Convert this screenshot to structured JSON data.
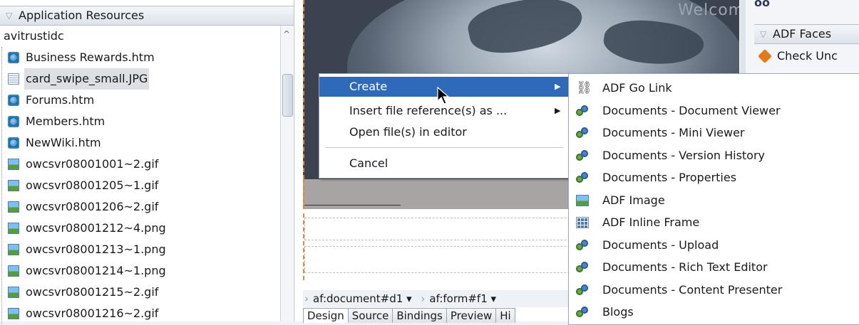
{
  "left_panel": {
    "header": "Application Resources",
    "root": "avitrustidc",
    "files": [
      {
        "name": "Business Rewards.htm",
        "icon": "html-page-icon"
      },
      {
        "name": "card_swipe_small.JPG",
        "icon": "document-icon"
      },
      {
        "name": "Forums.htm",
        "icon": "html-page-icon"
      },
      {
        "name": "Members.htm",
        "icon": "html-page-icon"
      },
      {
        "name": "NewWiki.htm",
        "icon": "html-page-icon"
      },
      {
        "name": "owcsvr08001001~2.gif",
        "icon": "image-icon"
      },
      {
        "name": "owcsvr08001205~1.gif",
        "icon": "image-icon"
      },
      {
        "name": "owcsvr08001206~2.gif",
        "icon": "image-icon"
      },
      {
        "name": "owcsvr08001212~4.png",
        "icon": "image-icon"
      },
      {
        "name": "owcsvr08001213~1.png",
        "icon": "image-icon"
      },
      {
        "name": "owcsvr08001214~1.png",
        "icon": "image-icon"
      },
      {
        "name": "owcsvr08001215~2.gif",
        "icon": "image-icon"
      },
      {
        "name": "owcsvr08001216~2.gif",
        "icon": "image-icon"
      }
    ],
    "selected_index": 1
  },
  "editor": {
    "welcome_text": "Welcom",
    "breadcrumb": [
      "af:document#d1 ▾",
      "af:form#f1 ▾"
    ],
    "tabs": [
      "Design",
      "Source",
      "Bindings",
      "Preview",
      "Hi"
    ],
    "active_tab": "Design"
  },
  "right_panel": {
    "header": "ADF Faces",
    "item": "Check Unc"
  },
  "context_menu": {
    "items": [
      "Create",
      "Insert file reference(s) as ...",
      "Open file(s) in editor",
      "Cancel"
    ],
    "highlight_color": "#2f6ab8"
  },
  "submenu": {
    "items": [
      {
        "label": "ADF Go Link",
        "icon": "link-icon"
      },
      {
        "label": "Documents - Document Viewer",
        "icon": "component-icon"
      },
      {
        "label": "Documents - Mini Viewer",
        "icon": "component-icon"
      },
      {
        "label": "Documents - Version History",
        "icon": "component-icon"
      },
      {
        "label": "Documents - Properties",
        "icon": "component-icon"
      },
      {
        "label": "ADF Image",
        "icon": "image-icon"
      },
      {
        "label": "ADF Inline Frame",
        "icon": "frame-icon"
      },
      {
        "label": "Documents - Upload",
        "icon": "component-icon"
      },
      {
        "label": "Documents - Rich Text Editor",
        "icon": "component-icon"
      },
      {
        "label": "Documents - Content Presenter",
        "icon": "component-icon"
      },
      {
        "label": "Blogs",
        "icon": "component-icon"
      }
    ]
  }
}
